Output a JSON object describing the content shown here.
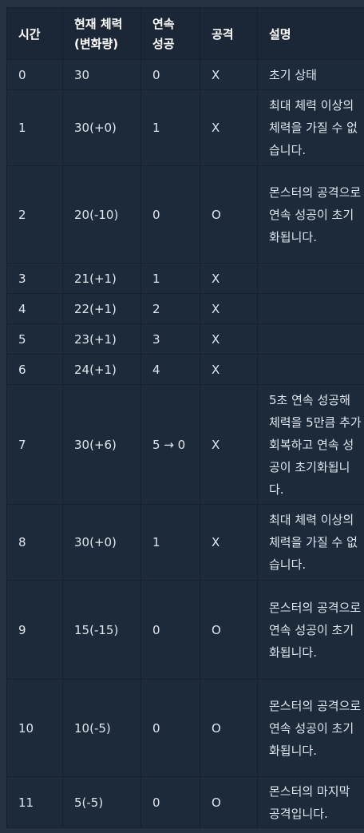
{
  "headers": {
    "time": "시간",
    "hp": "현재 체력\n(변화량)",
    "streak": "연속\n성공",
    "attack": "공격",
    "desc": "설명"
  },
  "rows": [
    {
      "time": "0",
      "hp": "30",
      "streak": "0",
      "attack": "X",
      "desc": "초기 상태"
    },
    {
      "time": "1",
      "hp": "30(+0)",
      "streak": "1",
      "attack": "X",
      "desc": "최대 체력 이상의 체력을 가질 수 없습니다."
    },
    {
      "time": "2",
      "hp": "20(-10)",
      "streak": "0",
      "attack": "O",
      "desc": "몬스터의 공격으로 연속 성공이 초기화됩니다."
    },
    {
      "time": "3",
      "hp": "21(+1)",
      "streak": "1",
      "attack": "X",
      "desc": ""
    },
    {
      "time": "4",
      "hp": "22(+1)",
      "streak": "2",
      "attack": "X",
      "desc": ""
    },
    {
      "time": "5",
      "hp": "23(+1)",
      "streak": "3",
      "attack": "X",
      "desc": ""
    },
    {
      "time": "6",
      "hp": "24(+1)",
      "streak": "4",
      "attack": "X",
      "desc": ""
    },
    {
      "time": "7",
      "hp": "30(+6)",
      "streak": "5 → 0",
      "attack": "X",
      "desc": "5초 연속 성공해 체력을 5만큼 추가 회복하고 연속 성공이 초기화됩니다."
    },
    {
      "time": "8",
      "hp": "30(+0)",
      "streak": "1",
      "attack": "X",
      "desc": "최대 체력 이상의 체력을 가질 수 없습니다."
    },
    {
      "time": "9",
      "hp": "15(-15)",
      "streak": "0",
      "attack": "O",
      "desc": "몬스터의 공격으로 연속 성공이 초기화됩니다."
    },
    {
      "time": "10",
      "hp": "10(-5)",
      "streak": "0",
      "attack": "O",
      "desc": "몬스터의 공격으로 연속 성공이 초기화됩니다."
    },
    {
      "time": "11",
      "hp": "5(-5)",
      "streak": "0",
      "attack": "O",
      "desc": "몬스터의 마지막 공격입니다."
    }
  ]
}
